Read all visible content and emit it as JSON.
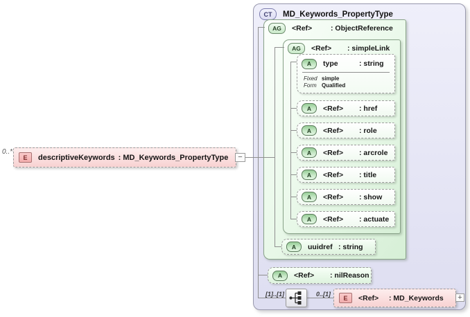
{
  "element": {
    "cardinality": "0..*",
    "icon": "E",
    "label": "descriptiveKeywords",
    "type_suffix": ": MD_Keywords_PropertyType",
    "collapse_glyph": "−"
  },
  "ct": {
    "icon": "CT",
    "title": "MD_Keywords_PropertyType",
    "object_reference": {
      "icon": "AG",
      "name": "<Ref>",
      "type": ": ObjectReference"
    },
    "simple_link": {
      "icon": "AG",
      "name": "<Ref>",
      "type": ": simpleLink",
      "type_attr": {
        "icon": "A",
        "name": "type",
        "type": ": string",
        "facets": [
          {
            "label": "Fixed",
            "value": "simple"
          },
          {
            "label": "Form",
            "value": "Qualified"
          }
        ]
      },
      "attrs": [
        {
          "icon": "A",
          "name": "<Ref>",
          "type": ": href"
        },
        {
          "icon": "A",
          "name": "<Ref>",
          "type": ": role"
        },
        {
          "icon": "A",
          "name": "<Ref>",
          "type": ": arcrole"
        },
        {
          "icon": "A",
          "name": "<Ref>",
          "type": ": title"
        },
        {
          "icon": "A",
          "name": "<Ref>",
          "type": ": show"
        },
        {
          "icon": "A",
          "name": "<Ref>",
          "type": ": actuate"
        }
      ]
    },
    "uuidref": {
      "icon": "A",
      "name": "uuidref",
      "type": ": string"
    },
    "nil_reason": {
      "icon": "A",
      "name": "<Ref>",
      "type": ": nilReason"
    },
    "sequence": {
      "left_cardinality": "[1]..[1]",
      "right_cardinality": "0..[1]"
    },
    "md_keywords": {
      "icon": "E",
      "name": "<Ref>",
      "type": ": MD_Keywords",
      "expand_glyph": "+"
    }
  },
  "colors": {
    "element_pink": "#f8d2d2",
    "attribute_green": "#d6efd6",
    "complex_type_lavender": "#dedef1",
    "connector_gray": "#8f8f8f"
  }
}
